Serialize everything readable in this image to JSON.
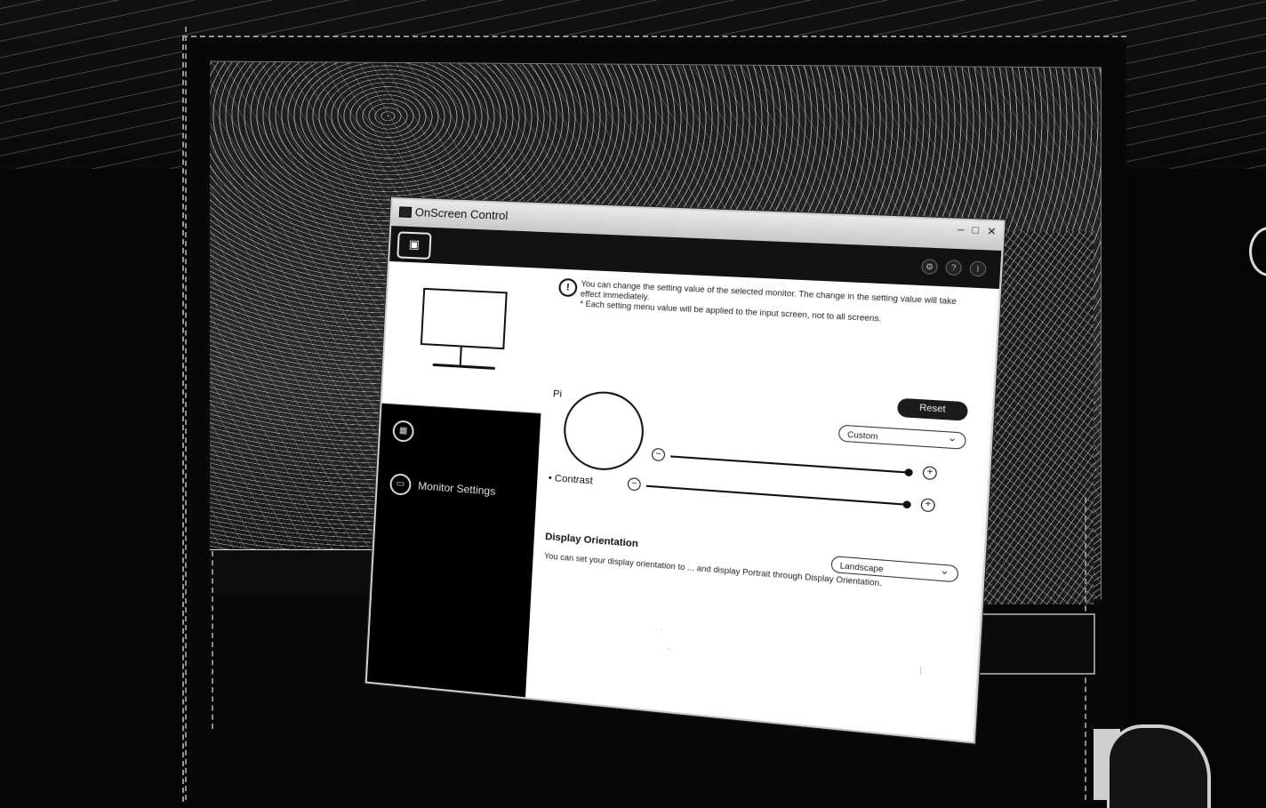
{
  "window": {
    "title": "OnScreen Control",
    "controls": [
      "–",
      "□",
      "✕"
    ]
  },
  "topbar": {
    "tabs": [
      "",
      "",
      "",
      ""
    ],
    "tools": [
      "⚙",
      "?",
      "i"
    ]
  },
  "sidebar": {
    "items": [
      {
        "label": "",
        "icon": "screen-split-icon"
      },
      {
        "label": "Monitor Settings",
        "icon": "monitor-settings-icon"
      }
    ]
  },
  "notice": {
    "line1": "You can change the setting value of the selected monitor. The change in the setting value will take effect immediately.",
    "line2": "* Each setting menu value will be applied to the input screen, not to all screens."
  },
  "picture_mode": {
    "label": "Pi",
    "reset_label": "Reset",
    "select_value": "Custom"
  },
  "sliders": [
    {
      "label": "",
      "value": 1.0
    },
    {
      "label": "• Contrast",
      "value": 1.0
    }
  ],
  "display_orientation": {
    "title": "Display Orientation",
    "desc": "You can set your display orientation to ... and display Portrait through Display Orientation.",
    "select_value": "Landscape"
  }
}
